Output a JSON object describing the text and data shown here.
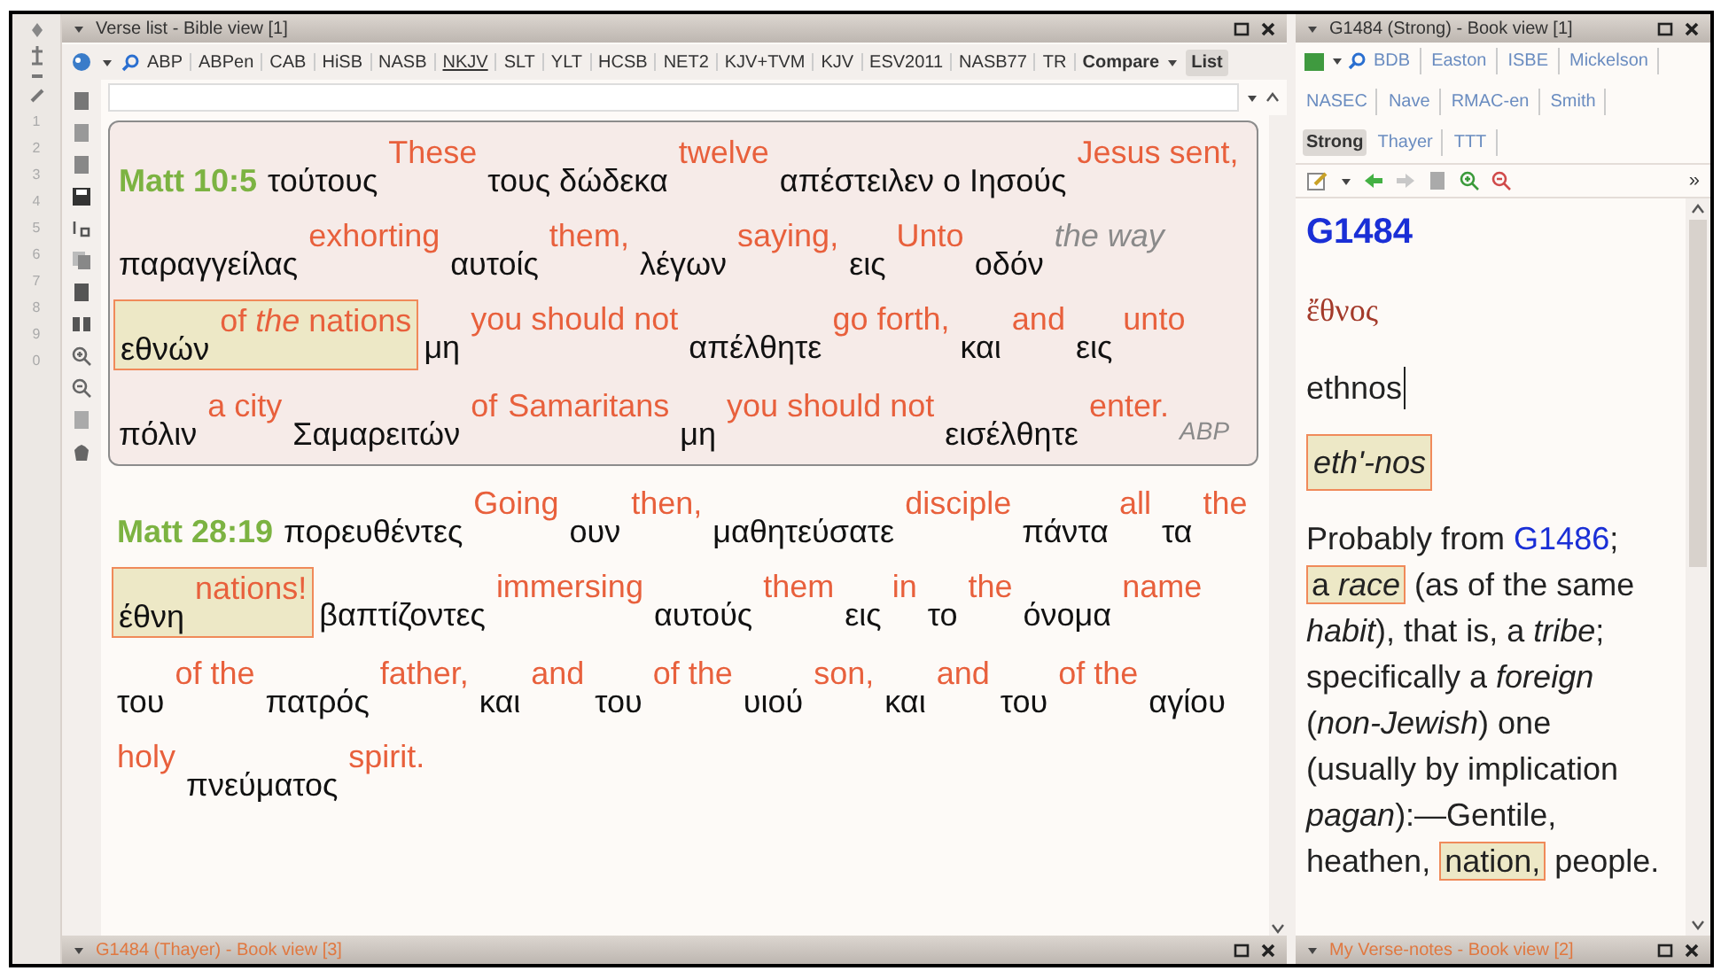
{
  "quick_keys": [
    "1",
    "2",
    "3",
    "4",
    "5",
    "6",
    "7",
    "8",
    "9",
    "0"
  ],
  "verse_list": {
    "title": "Verse list - Bible view [1]",
    "translations": [
      {
        "label": "ABP",
        "selected": false
      },
      {
        "label": "ABPen",
        "selected": false
      },
      {
        "label": "CAB",
        "selected": false
      },
      {
        "label": "HiSB",
        "selected": false
      },
      {
        "label": "NASB",
        "selected": false
      },
      {
        "label": "NKJV",
        "selected": true
      },
      {
        "label": "SLT",
        "selected": false
      },
      {
        "label": "YLT",
        "selected": false
      },
      {
        "label": "HCSB",
        "selected": false
      },
      {
        "label": "NET2",
        "selected": false
      },
      {
        "label": "KJV+TVM",
        "selected": false
      },
      {
        "label": "KJV",
        "selected": false
      },
      {
        "label": "ESV2011",
        "selected": false
      },
      {
        "label": "NASB77",
        "selected": false
      },
      {
        "label": "TR",
        "selected": false
      }
    ],
    "compare": "Compare",
    "list": {
      "label": "List",
      "on": true
    },
    "verses": [
      {
        "boxed": true,
        "segments": [
          {
            "kind": "ref",
            "text": "Matt 10:5"
          },
          {
            "kind": "gr",
            "text": "τούτους"
          },
          {
            "kind": "en",
            "text": "These"
          },
          {
            "kind": "gr",
            "text": "τους δώδεκα"
          },
          {
            "kind": "en",
            "text": "twelve"
          },
          {
            "kind": "gr",
            "text": "απέστειλεν ο Ιησούς"
          },
          {
            "kind": "en",
            "text": "Jesus sent,"
          },
          {
            "kind": "gr",
            "text": "παραγγείλας"
          },
          {
            "kind": "en",
            "text": "exhorting"
          },
          {
            "kind": "gr",
            "text": "αυτοίς"
          },
          {
            "kind": "en",
            "text": "them,"
          },
          {
            "kind": "gr",
            "text": "λέγων"
          },
          {
            "kind": "en",
            "text": "saying,"
          },
          {
            "kind": "gr",
            "text": "εις"
          },
          {
            "kind": "en",
            "text": "Unto"
          },
          {
            "kind": "gr",
            "text": "οδόν"
          },
          {
            "kind": "added",
            "text": "the way"
          },
          {
            "kind": "group",
            "segments": [
              {
                "kind": "gr",
                "text": "εθνών"
              },
              {
                "kind": "en",
                "text": "of *the* nations"
              }
            ]
          },
          {
            "kind": "gr",
            "text": "μη"
          },
          {
            "kind": "en",
            "text": "you should not"
          },
          {
            "kind": "gr",
            "text": "απέλθητε"
          },
          {
            "kind": "en",
            "text": "go forth,"
          },
          {
            "kind": "gr",
            "text": "και"
          },
          {
            "kind": "en",
            "text": "and"
          },
          {
            "kind": "gr",
            "text": "εις"
          },
          {
            "kind": "en",
            "text": "unto"
          },
          {
            "kind": "gr",
            "text": "πόλιν"
          },
          {
            "kind": "en",
            "text": "a city"
          },
          {
            "kind": "gr",
            "text": "Σαμαρειτών"
          },
          {
            "kind": "en",
            "text": "of"
          },
          {
            "kind": "en",
            "text": "Samaritans"
          },
          {
            "kind": "gr",
            "text": "μη"
          },
          {
            "kind": "en",
            "text": "you should not"
          },
          {
            "kind": "gr",
            "text": "εισέλθητε"
          },
          {
            "kind": "en",
            "text": "enter."
          },
          {
            "kind": "source",
            "text": "ABP"
          }
        ]
      },
      {
        "boxed": false,
        "segments": [
          {
            "kind": "ref",
            "text": "Matt 28:19"
          },
          {
            "kind": "gr",
            "text": "πορευθέντες"
          },
          {
            "kind": "en",
            "text": "Going"
          },
          {
            "kind": "gr",
            "text": "ουν"
          },
          {
            "kind": "en",
            "text": "then,"
          },
          {
            "kind": "gr",
            "text": "μαθητεύσατε"
          },
          {
            "kind": "en",
            "text": "disciple"
          },
          {
            "kind": "gr",
            "text": "πάντα"
          },
          {
            "kind": "en",
            "text": "all"
          },
          {
            "kind": "gr",
            "text": "τα"
          },
          {
            "kind": "en",
            "text": "the"
          },
          {
            "kind": "group",
            "segments": [
              {
                "kind": "gr",
                "text": "έθνη"
              },
              {
                "kind": "en",
                "text": "nations!"
              }
            ]
          },
          {
            "kind": "gr",
            "text": "βαπτίζοντες"
          },
          {
            "kind": "en",
            "text": "immersing"
          },
          {
            "kind": "gr",
            "text": "αυτούς"
          },
          {
            "kind": "en",
            "text": "them"
          },
          {
            "kind": "gr",
            "text": "εις"
          },
          {
            "kind": "en",
            "text": "in"
          },
          {
            "kind": "gr",
            "text": "το"
          },
          {
            "kind": "en",
            "text": "the"
          },
          {
            "kind": "gr",
            "text": "όνομα"
          },
          {
            "kind": "en",
            "text": "name"
          },
          {
            "kind": "gr",
            "text": "του"
          },
          {
            "kind": "en",
            "text": "of the"
          },
          {
            "kind": "gr",
            "text": "πατρός"
          },
          {
            "kind": "en",
            "text": "father,"
          },
          {
            "kind": "gr",
            "text": "και"
          },
          {
            "kind": "en",
            "text": "and"
          },
          {
            "kind": "gr",
            "text": "του"
          },
          {
            "kind": "en",
            "text": "of the"
          },
          {
            "kind": "gr",
            "text": "υιού"
          },
          {
            "kind": "en",
            "text": "son,"
          },
          {
            "kind": "gr",
            "text": "και"
          },
          {
            "kind": "en",
            "text": "and"
          },
          {
            "kind": "gr",
            "text": "του"
          },
          {
            "kind": "en",
            "text": "of the"
          },
          {
            "kind": "gr",
            "text": "αγίου"
          },
          {
            "kind": "en",
            "text": "holy"
          },
          {
            "kind": "gr",
            "text": "πνεύματος"
          },
          {
            "kind": "en",
            "text": "spirit."
          }
        ]
      }
    ]
  },
  "book_view": {
    "title": "G1484 (Strong) - Book view [1]",
    "books": [
      {
        "label": "BDB",
        "selected": false
      },
      {
        "label": "Easton",
        "selected": false
      },
      {
        "label": "ISBE",
        "selected": false
      },
      {
        "label": "Mickelson",
        "selected": false
      },
      {
        "label": "NASEC",
        "selected": false
      },
      {
        "label": "Nave",
        "selected": false
      },
      {
        "label": "RMAC-en",
        "selected": false
      },
      {
        "label": "Smith",
        "selected": false
      },
      {
        "label": "Strong",
        "selected": true
      },
      {
        "label": "Thayer",
        "selected": false
      },
      {
        "label": "TTT",
        "selected": false
      }
    ],
    "overflow": "»",
    "entry": {
      "number": "G1484",
      "greek": "ἔθνος",
      "transliteration": "ethnos",
      "pronunciation": "eth'-nos",
      "definition": [
        {
          "kind": "text",
          "text": "Probably from "
        },
        {
          "kind": "link",
          "text": "G1486"
        },
        {
          "kind": "text",
          "text": "; "
        },
        {
          "kind": "highlight",
          "text": "a *race*"
        },
        {
          "kind": "text",
          "text": " (as of the same *habit*), that is, a *tribe*; specifically a *foreign* (*non-Jewish*) one (usually by implication *pagan*):—Gentile, heathen, "
        },
        {
          "kind": "highlight",
          "text": "nation,"
        },
        {
          "kind": "text",
          "text": " people."
        }
      ]
    }
  },
  "bottom_panels": [
    {
      "title": "G1484 (Thayer) - Book view [3]"
    },
    {
      "title": "My Verse-notes - Book view [2]"
    }
  ]
}
